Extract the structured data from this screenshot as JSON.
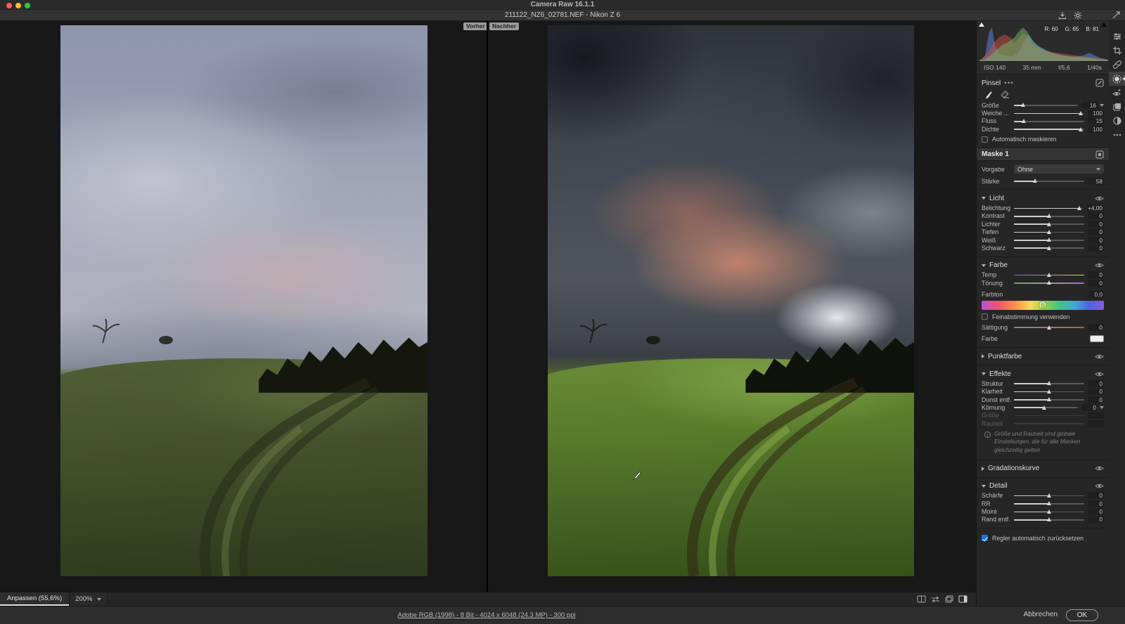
{
  "header": {
    "app_title": "Camera Raw 16.1.1",
    "filename": "211122_NZ6_02781.NEF - Nikon Z 6"
  },
  "compare": {
    "before": "Vorher",
    "after": "Nachher"
  },
  "histogram": {
    "r": "R: 60",
    "g": "G: 65",
    "b": "B: 81",
    "iso": "ISO 140",
    "focal": "35 mm",
    "aperture": "f/5,6",
    "shutter": "1/40s"
  },
  "brush": {
    "title": "Pinsel",
    "menu": "•••",
    "sliders": [
      {
        "label": "Größe",
        "value": "16",
        "pos": 14
      },
      {
        "label": "Weiche ...",
        "value": "100",
        "pos": 95
      },
      {
        "label": "Fluss",
        "value": "15",
        "pos": 14
      },
      {
        "label": "Dichte",
        "value": "100",
        "pos": 95
      }
    ],
    "automask": "Automatisch maskieren"
  },
  "mask": {
    "title": "Maske 1",
    "preset_label": "Vorgabe",
    "preset_value": "Ohne",
    "strength": {
      "label": "Stärke",
      "value": "58",
      "pos": 30
    }
  },
  "light": {
    "title": "Licht",
    "rows": [
      {
        "label": "Belichtung",
        "value": "+4,00",
        "pos": 95
      },
      {
        "label": "Kontrast",
        "value": "0",
        "pos": 50
      },
      {
        "label": "Lichter",
        "value": "0",
        "pos": 50
      },
      {
        "label": "Tiefen",
        "value": "0",
        "pos": 50
      },
      {
        "label": "Weiß",
        "value": "0",
        "pos": 50
      },
      {
        "label": "Schwarz",
        "value": "0",
        "pos": 50
      }
    ]
  },
  "color": {
    "title": "Farbe",
    "temp": {
      "label": "Temp",
      "pos": 50
    },
    "tint": {
      "label": "Tönung",
      "pos": 50
    },
    "hue": {
      "label": "Farbton",
      "value": "0,0",
      "pos": 50
    },
    "fine_tune": "Feinabstimmung verwenden",
    "saturation": {
      "label": "Sättigung",
      "value": "0",
      "pos": 50
    },
    "swatch_label": "Farbe"
  },
  "point_color": {
    "title": "Punktfarbe"
  },
  "effects": {
    "title": "Effekte",
    "rows": [
      {
        "label": "Struktur",
        "value": "0",
        "pos": 50
      },
      {
        "label": "Klarheit",
        "value": "0",
        "pos": 50
      },
      {
        "label": "Dunst entf.",
        "value": "0",
        "pos": 50
      },
      {
        "label": "Körnung",
        "value": "0",
        "pos": 47
      },
      {
        "label": "Größe",
        "value": "",
        "pos": 50
      },
      {
        "label": "Rauheit",
        "value": "",
        "pos": 50
      }
    ],
    "note": "Größe und Rauheit sind globale Einstellungen, die für alle Masken gleichzeitig gelten"
  },
  "curve": {
    "title": "Gradationskurve"
  },
  "detail": {
    "title": "Detail",
    "rows": [
      {
        "label": "Schärfe",
        "value": "0",
        "pos": 50
      },
      {
        "label": "RR",
        "value": "0",
        "pos": 50
      },
      {
        "label": "Moiré",
        "value": "0",
        "pos": 50
      },
      {
        "label": "Rand entf.",
        "value": "0",
        "pos": 50
      }
    ]
  },
  "reset_label": "Regler automatisch zurücksetzen",
  "checks": {
    "automask": false,
    "fine_tune": false,
    "reset": true
  },
  "statusbar": {
    "fit": "Anpassen (55,6%)",
    "zoom": "200%"
  },
  "bottombar": {
    "workflow_link": "Adobe RGB (1998) - 8 Bit - 4024 x 6048 (24.3 MP) - 300 ppi",
    "cancel": "Abbrechen",
    "ok": "OK"
  },
  "colors": {
    "accent_blue": "#1473e6",
    "panel_bg": "#262626",
    "canvas_bg": "#181818"
  }
}
